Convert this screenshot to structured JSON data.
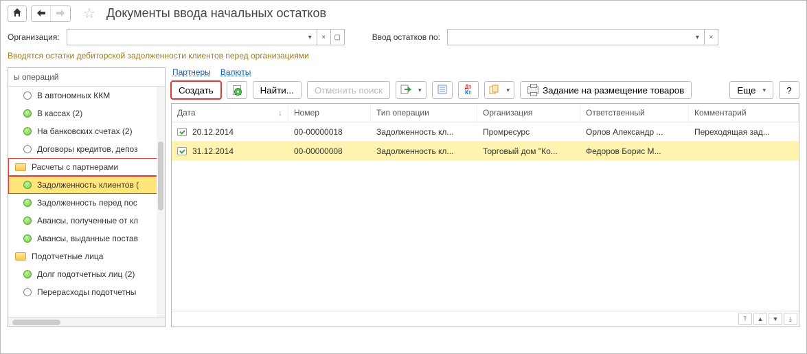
{
  "title": "Документы ввода начальных остатков",
  "filters": {
    "org_label": "Организация:",
    "org_value": "",
    "balance_label": "Ввод остатков по:",
    "balance_value": ""
  },
  "hint": "Вводятся остатки дебиторской задолженности клиентов перед организациями",
  "tree": {
    "header": "ы операций",
    "items": [
      {
        "label": "В автономных ККМ",
        "green": false,
        "indent": true
      },
      {
        "label": "В кассах (2)",
        "green": true,
        "indent": true
      },
      {
        "label": "На банковских счетах (2)",
        "green": true,
        "indent": true
      },
      {
        "label": "Договоры кредитов, депоз",
        "green": false,
        "indent": true
      },
      {
        "label": "Расчеты с партнерами",
        "folder": true,
        "hl": 1
      },
      {
        "label": "Задолженность клиентов (",
        "green": true,
        "indent": true,
        "hl": 2
      },
      {
        "label": "Задолженность перед пос",
        "green": true,
        "indent": true
      },
      {
        "label": "Авансы, полученные от кл",
        "green": true,
        "indent": true
      },
      {
        "label": "Авансы, выданные постав",
        "green": true,
        "indent": true
      },
      {
        "label": "Подотчетные лица",
        "folder": true
      },
      {
        "label": "Долг подотчетных лиц (2)",
        "green": true,
        "indent": true
      },
      {
        "label": "Перерасходы подотчетны",
        "green": false,
        "indent": true
      }
    ]
  },
  "tabs": {
    "partners": "Партнеры",
    "currencies": "Валюты"
  },
  "toolbar": {
    "create": "Создать",
    "find": "Найти...",
    "cancel_search": "Отменить поиск",
    "placement_task": "Задание на размещение товаров",
    "more": "Еще",
    "help": "?"
  },
  "grid": {
    "columns": {
      "date": "Дата",
      "number": "Номер",
      "type": "Тип операции",
      "org": "Организация",
      "resp": "Ответственный",
      "comment": "Комментарий"
    },
    "rows": [
      {
        "date": "20.12.2014",
        "number": "00-00000018",
        "type": "Задолженность кл...",
        "org": "Промресурс",
        "resp": "Орлов Александр ...",
        "comment": "Переходящая зад...",
        "selected": false
      },
      {
        "date": "31.12.2014",
        "number": "00-00000008",
        "type": "Задолженность кл...",
        "org": "Торговый дом \"Ко...",
        "resp": "Федоров Борис М...",
        "comment": "",
        "selected": true
      }
    ]
  }
}
